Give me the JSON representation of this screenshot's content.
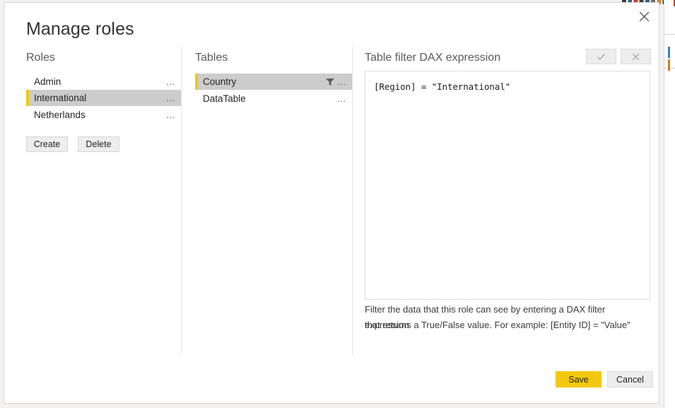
{
  "dialog": {
    "title": "Manage roles",
    "close_label": "Close"
  },
  "roles_panel": {
    "heading": "Roles",
    "items": [
      {
        "label": "Admin",
        "selected": false,
        "menu": "…"
      },
      {
        "label": "International",
        "selected": true,
        "menu": "…"
      },
      {
        "label": "Netherlands",
        "selected": false,
        "menu": "…"
      }
    ],
    "create_label": "Create",
    "delete_label": "Delete"
  },
  "tables_panel": {
    "heading": "Tables",
    "items": [
      {
        "label": "Country",
        "selected": true,
        "has_filter": true,
        "menu": "…"
      },
      {
        "label": "DataTable",
        "selected": false,
        "has_filter": false,
        "menu": "…"
      }
    ]
  },
  "dax_panel": {
    "heading": "Table filter DAX expression",
    "accept_label": "Accept expression",
    "reject_label": "Discard expression",
    "expression": "[Region] = \"International\"",
    "placeholder": "",
    "help_line_1": "Filter the data that this role can see by entering a DAX filter expression",
    "help_line_2": "that returns a True/False value. For example: [Entity ID] = \"Value\""
  },
  "footer": {
    "save_label": "Save",
    "cancel_label": "Cancel"
  },
  "colors": {
    "accent_yellow": "#f2c811",
    "selection_gray": "#cccccc",
    "button_gray": "#ededed",
    "dialog_border": "#d2d2d2",
    "text_dark": "#252525",
    "heading_gray": "#5a5a5a"
  }
}
